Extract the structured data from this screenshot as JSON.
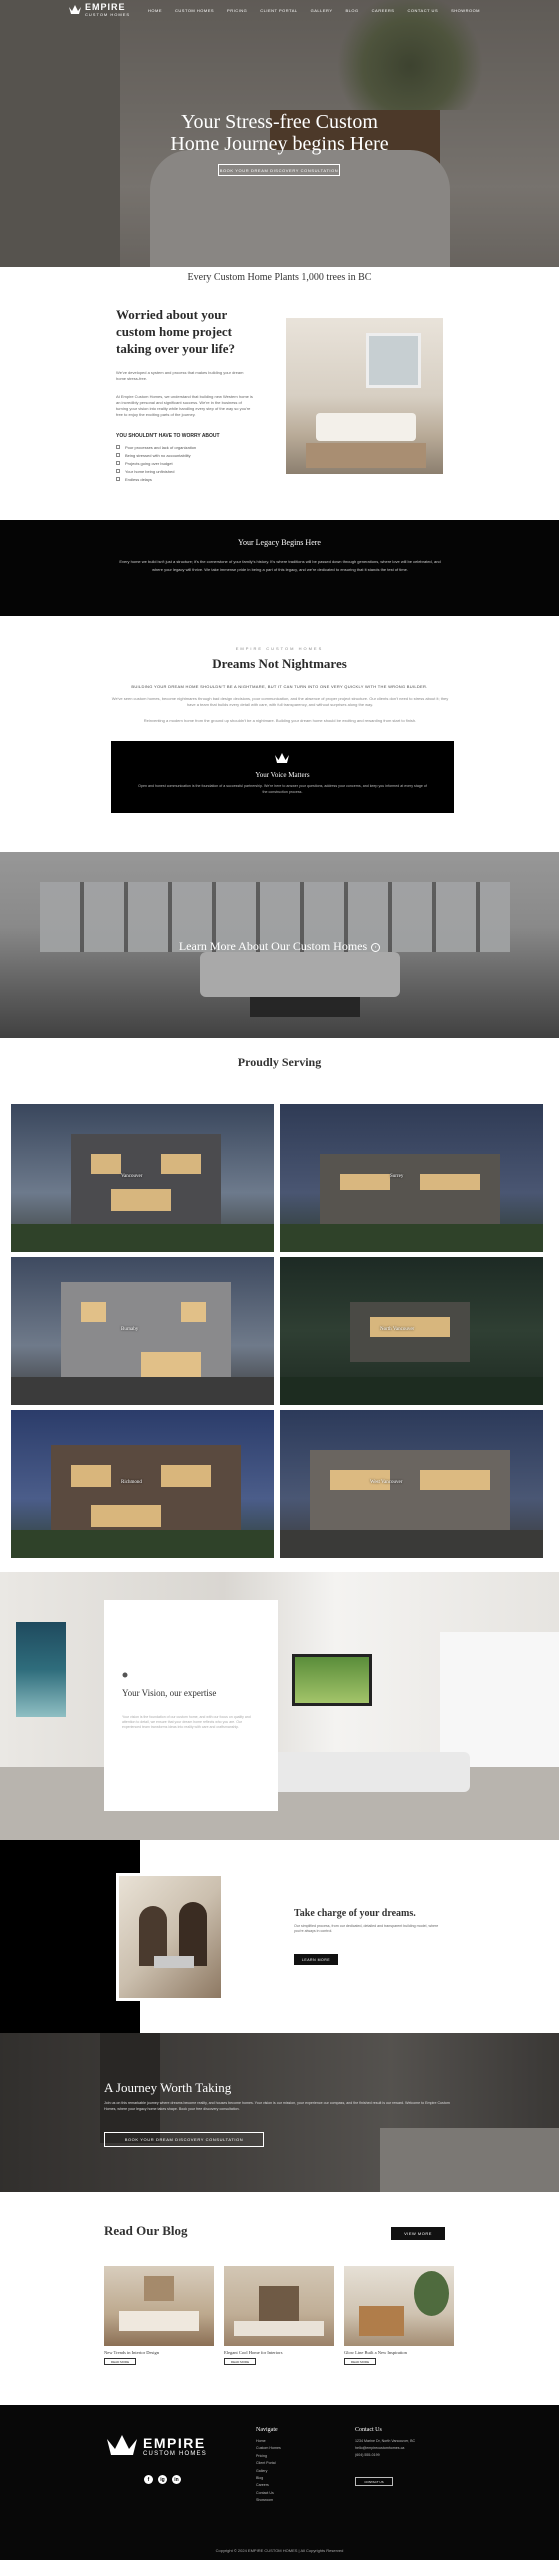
{
  "brand": {
    "name": "EMPIRE",
    "tagline": "CUSTOM HOMES"
  },
  "nav": {
    "items": [
      "Home",
      "Custom Homes",
      "Pricing",
      "Client Portal",
      "Gallery",
      "Blog",
      "Careers",
      "Contact Us",
      "Showroom"
    ]
  },
  "hero": {
    "title_line1": "Your Stress-free Custom",
    "title_line2": "Home Journey begins Here",
    "cta": "Book Your Dream Discovery Consultation"
  },
  "trees": "Every Custom Home Plants 1,000 trees in BC",
  "worried": {
    "title": "Worried about your custom home project taking over your life?",
    "p1": "We've developed a system and process that makes building your dream home stress-free.",
    "p2": "At Empire Custom Homes, we understand that building new Western home is an incredibly personal and significant success. We're in the business of turning your vision into reality while handling every step of the way so you're free to enjoy the exciting parts of the journey.",
    "subhead": "YOU SHOULDN'T HAVE TO WORRY ABOUT",
    "items": [
      "Poor processes and lack of organization",
      "Being stressed with no accountability",
      "Projects going over budget",
      "Your home being unfinished",
      "Endless delays"
    ]
  },
  "legacy": {
    "title": "Your Legacy Begins Here",
    "text": "Every home we build isn't just a structure; it's the cornerstone of your family's history. It's where traditions will be passed down through generations, where love will be celebrated, and where your legacy will thrive. We take immense pride in being a part of this legacy, and we're dedicated to ensuring that it stands the test of time."
  },
  "dreams": {
    "kicker": "Empire Custom Homes",
    "title": "Dreams Not Nightmares",
    "line1": "BUILDING YOUR DREAM HOME SHOULDN'T BE A NIGHTMARE, but it can turn into one very quickly with the wrong builder.",
    "p1": "We've seen custom homes, become nightmares through bad design decisions, poor communication, and the absence of proper project structure. Our clients don't need to stress about it; they have a team that builds every detail with care, with full transparency, and without surprises along the way.",
    "p2": "Reinventing a modern home from the ground up shouldn't be a nightmare. Building your dream home should be exciting and rewarding from start to finish."
  },
  "voice": {
    "title": "Your Voice Matters",
    "text": "Open and honest communication is the foundation of a successful partnership. We're here to answer your questions, address your concerns, and keep you informed at every stage of the construction process."
  },
  "learn_more": {
    "label": "Learn More About Our Custom Homes",
    "icon": "arrow-circle-icon"
  },
  "serving": {
    "title": "Proudly Serving",
    "cities": [
      "Vancouver",
      "Surrey",
      "Burnaby",
      "North Vancouver",
      "Richmond",
      "West Vancouver"
    ]
  },
  "expertise": {
    "title": "Your Vision, our expertise",
    "text": "Your vision is the foundation of our custom home, and with our focus on quality and attention to detail, we ensure that your dream home reflects who you are. Our experienced team transforms ideas into reality with care and craftsmanship."
  },
  "take_charge": {
    "title": "Take charge of your dreams.",
    "text": "Our simplified process, from our dedicated, detailed and transparent building model, where you're always in control.",
    "button": "Learn More"
  },
  "journey": {
    "title": "A Journey Worth Taking",
    "text": "Join us on this remarkable journey where dreams become reality, and houses become homes. Your vision is our mission, your experience our compass, and the finished result is our reward. Welcome to Empire Custom Homes, where your legacy home takes shape. Book your free discovery consultation.",
    "button": "Book Your Dream Discovery Consultation"
  },
  "blog": {
    "title": "Read Our Blog",
    "button": "View More",
    "posts": [
      {
        "title": "New Trends in Interior Design",
        "read_more": "Read More"
      },
      {
        "title": "Elegant Cool Home for Interiors",
        "read_more": "Read More"
      },
      {
        "title": "Glow Line Built a New Inspiration",
        "read_more": "Read More"
      }
    ]
  },
  "footer": {
    "navigate_heading": "Navigate",
    "nav_items": [
      "Home",
      "Custom Homes",
      "Pricing",
      "Client Portal",
      "Gallery",
      "Blog",
      "Careers",
      "Contact Us",
      "Showroom"
    ],
    "contact_heading": "Contact Us",
    "contact_lines": [
      "1234 Marine Dr, North Vancouver, BC",
      "hello@empirecustomhomes.ca",
      "(604) 555-0199"
    ],
    "contact_button": "Contact Us",
    "social": [
      "f",
      "ig",
      "in"
    ],
    "copyright": "Copyright © 2024 EMPIRE CUSTOM HOMES | All Copyrights Reserved"
  },
  "colors": {
    "black": "#000000",
    "white": "#ffffff",
    "text": "#2a2a2a"
  }
}
